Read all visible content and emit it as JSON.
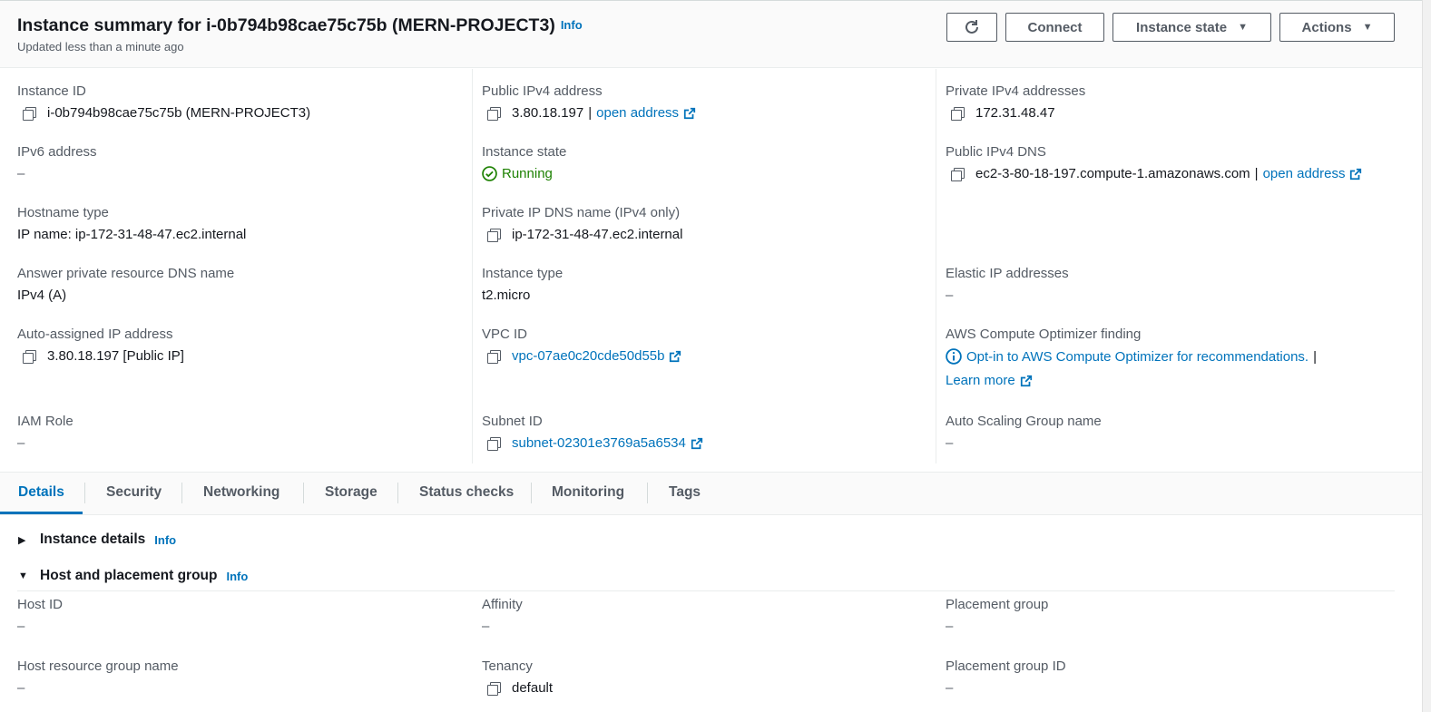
{
  "header": {
    "title": "Instance summary for i-0b794b98cae75c75b (MERN-PROJECT3)",
    "info": "Info",
    "updated": "Updated less than a minute ago",
    "buttons": {
      "connect": "Connect",
      "instance_state": "Instance state",
      "actions": "Actions"
    }
  },
  "summary": {
    "instance_id": {
      "label": "Instance ID",
      "value": "i-0b794b98cae75c75b (MERN-PROJECT3)"
    },
    "public_ipv4": {
      "label": "Public IPv4 address",
      "value": "3.80.18.197",
      "sep": "|",
      "link": "open address"
    },
    "private_ipv4": {
      "label": "Private IPv4 addresses",
      "value": "172.31.48.47"
    },
    "ipv6": {
      "label": "IPv6 address",
      "value": "–"
    },
    "instance_state": {
      "label": "Instance state",
      "value": "Running"
    },
    "public_dns": {
      "label": "Public IPv4 DNS",
      "value": "ec2-3-80-18-197.compute-1.amazonaws.com",
      "sep": "|",
      "link": "open address"
    },
    "hostname_type": {
      "label": "Hostname type",
      "value": "IP name: ip-172-31-48-47.ec2.internal"
    },
    "private_dns": {
      "label": "Private IP DNS name (IPv4 only)",
      "value": "ip-172-31-48-47.ec2.internal"
    },
    "answer_dns": {
      "label": "Answer private resource DNS name",
      "value": "IPv4 (A)"
    },
    "instance_type": {
      "label": "Instance type",
      "value": "t2.micro"
    },
    "elastic_ip": {
      "label": "Elastic IP addresses",
      "value": "–"
    },
    "auto_ip": {
      "label": "Auto-assigned IP address",
      "value": "3.80.18.197 [Public IP]"
    },
    "vpc_id": {
      "label": "VPC ID",
      "value": "vpc-07ae0c20cde50d55b"
    },
    "optimizer": {
      "label": "AWS Compute Optimizer finding",
      "value": "Opt-in to AWS Compute Optimizer for recommendations.",
      "sep": "|",
      "link": "Learn more"
    },
    "iam_role": {
      "label": "IAM Role",
      "value": "–"
    },
    "subnet_id": {
      "label": "Subnet ID",
      "value": "subnet-02301e3769a5a6534"
    },
    "asg_name": {
      "label": "Auto Scaling Group name",
      "value": "–"
    }
  },
  "tabs": [
    {
      "label": "Details"
    },
    {
      "label": "Security"
    },
    {
      "label": "Networking"
    },
    {
      "label": "Storage"
    },
    {
      "label": "Status checks"
    },
    {
      "label": "Monitoring"
    },
    {
      "label": "Tags"
    }
  ],
  "details": {
    "instance_details": {
      "title": "Instance details",
      "info": "Info"
    },
    "host_placement": {
      "title": "Host and placement group",
      "info": "Info"
    },
    "host_id": {
      "label": "Host ID",
      "value": "–"
    },
    "affinity": {
      "label": "Affinity",
      "value": "–"
    },
    "placement_group": {
      "label": "Placement group",
      "value": "–"
    },
    "host_rg_name": {
      "label": "Host resource group name",
      "value": "–"
    },
    "tenancy": {
      "label": "Tenancy",
      "value": "default"
    },
    "placement_group_id": {
      "label": "Placement group ID",
      "value": "–"
    }
  },
  "colors": {
    "link": "#0073bb",
    "running": "#1d8102",
    "text": "#16191f",
    "muted": "#545b64"
  }
}
